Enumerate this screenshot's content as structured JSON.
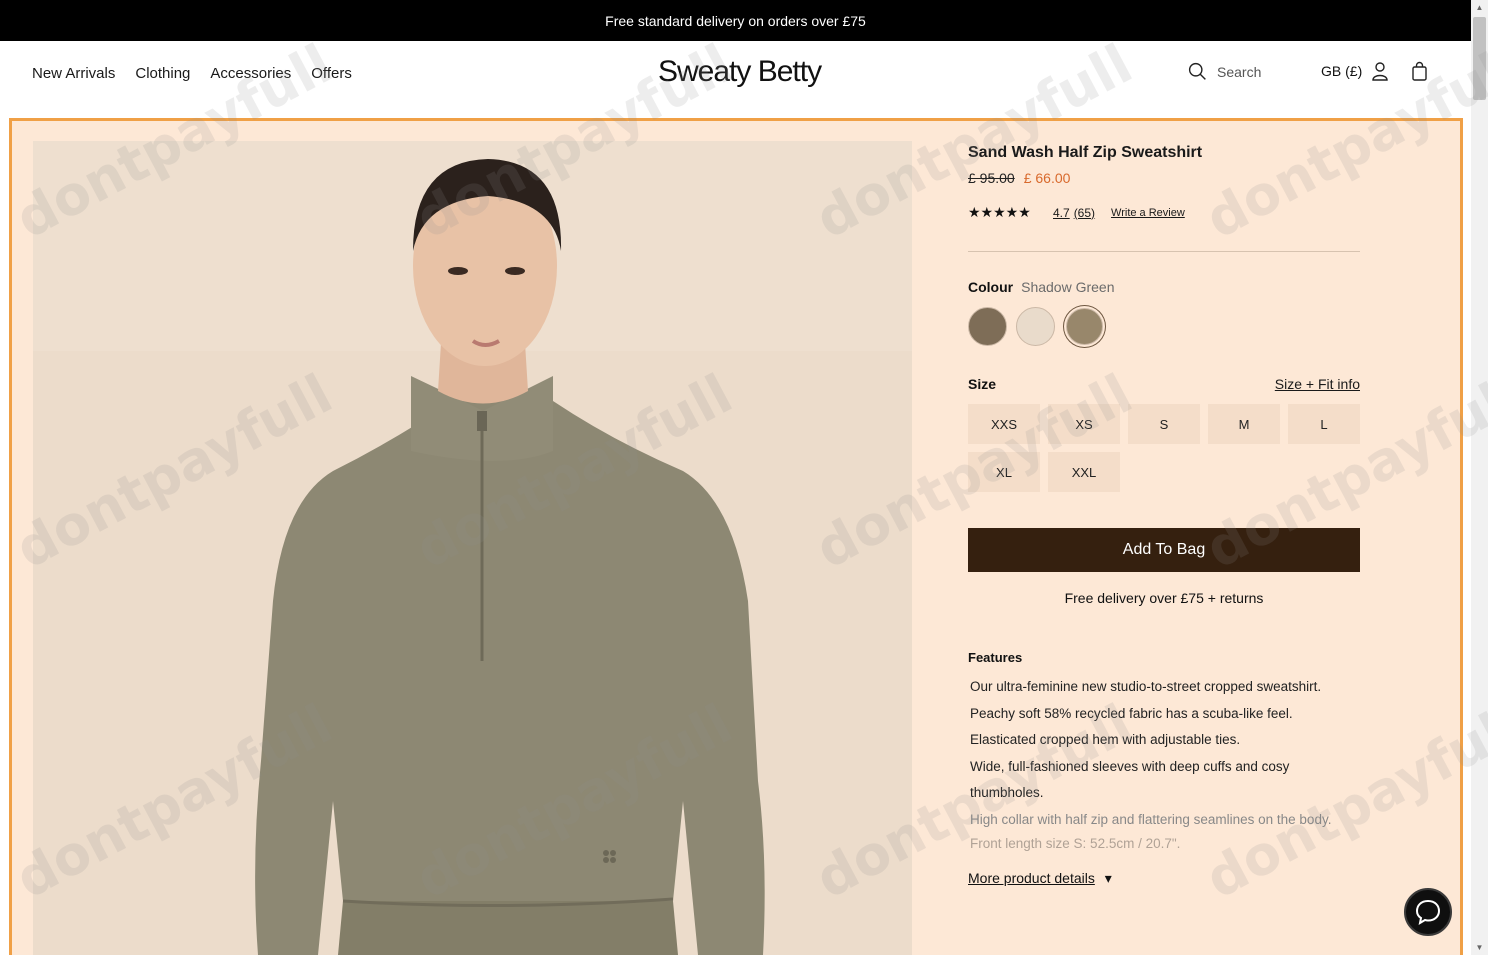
{
  "promo": {
    "text": "Free standard delivery on orders over £75"
  },
  "header": {
    "nav": [
      "New Arrivals",
      "Clothing",
      "Accessories",
      "Offers"
    ],
    "logo": "Sweaty Betty",
    "search_label": "Search",
    "locale": "GB (£)",
    "icons": [
      "search-icon",
      "account-icon",
      "bag-icon"
    ]
  },
  "product": {
    "title": "Sand Wash Half Zip Sweatshirt",
    "price_old": "£ 95.00",
    "price_new": "£ 66.00",
    "stars": "★★★★★",
    "rating": "4.7",
    "review_count": "(65)",
    "write_review": "Write a Review",
    "colour_label": "Colour",
    "colour_selected": "Shadow Green",
    "swatches": [
      {
        "name": "olive-brown",
        "color": "#7e6d57",
        "selected": false
      },
      {
        "name": "cream",
        "color": "#e9dbcb",
        "selected": false
      },
      {
        "name": "shadow-green",
        "color": "#98876b",
        "selected": true
      }
    ],
    "size_label": "Size",
    "size_info": "Size + Fit info",
    "sizes": [
      "XXS",
      "XS",
      "S",
      "M",
      "L",
      "XL",
      "XXL"
    ],
    "add_to_bag": "Add To Bag",
    "free_delivery": "Free delivery over £75 + returns",
    "features_label": "Features",
    "features": [
      "Our ultra-feminine new studio-to-street cropped sweatshirt.",
      "Peachy soft 58% recycled fabric has a scuba-like feel.",
      "Elasticated cropped hem with adjustable ties.",
      "Wide, full-fashioned sleeves with deep cuffs and cosy thumbholes.",
      "High collar with half zip and flattering seamlines on the body.",
      "Front length size S: 52.5cm / 20.7\"."
    ],
    "more_details": "More product details",
    "more_details_arrow": "▾"
  },
  "watermark": "dontpayfull",
  "colors": {
    "accent_orange": "#f0a046",
    "panel_bg": "#fde8d6",
    "button_dark": "#35200f",
    "sale_price": "#d8692c"
  }
}
